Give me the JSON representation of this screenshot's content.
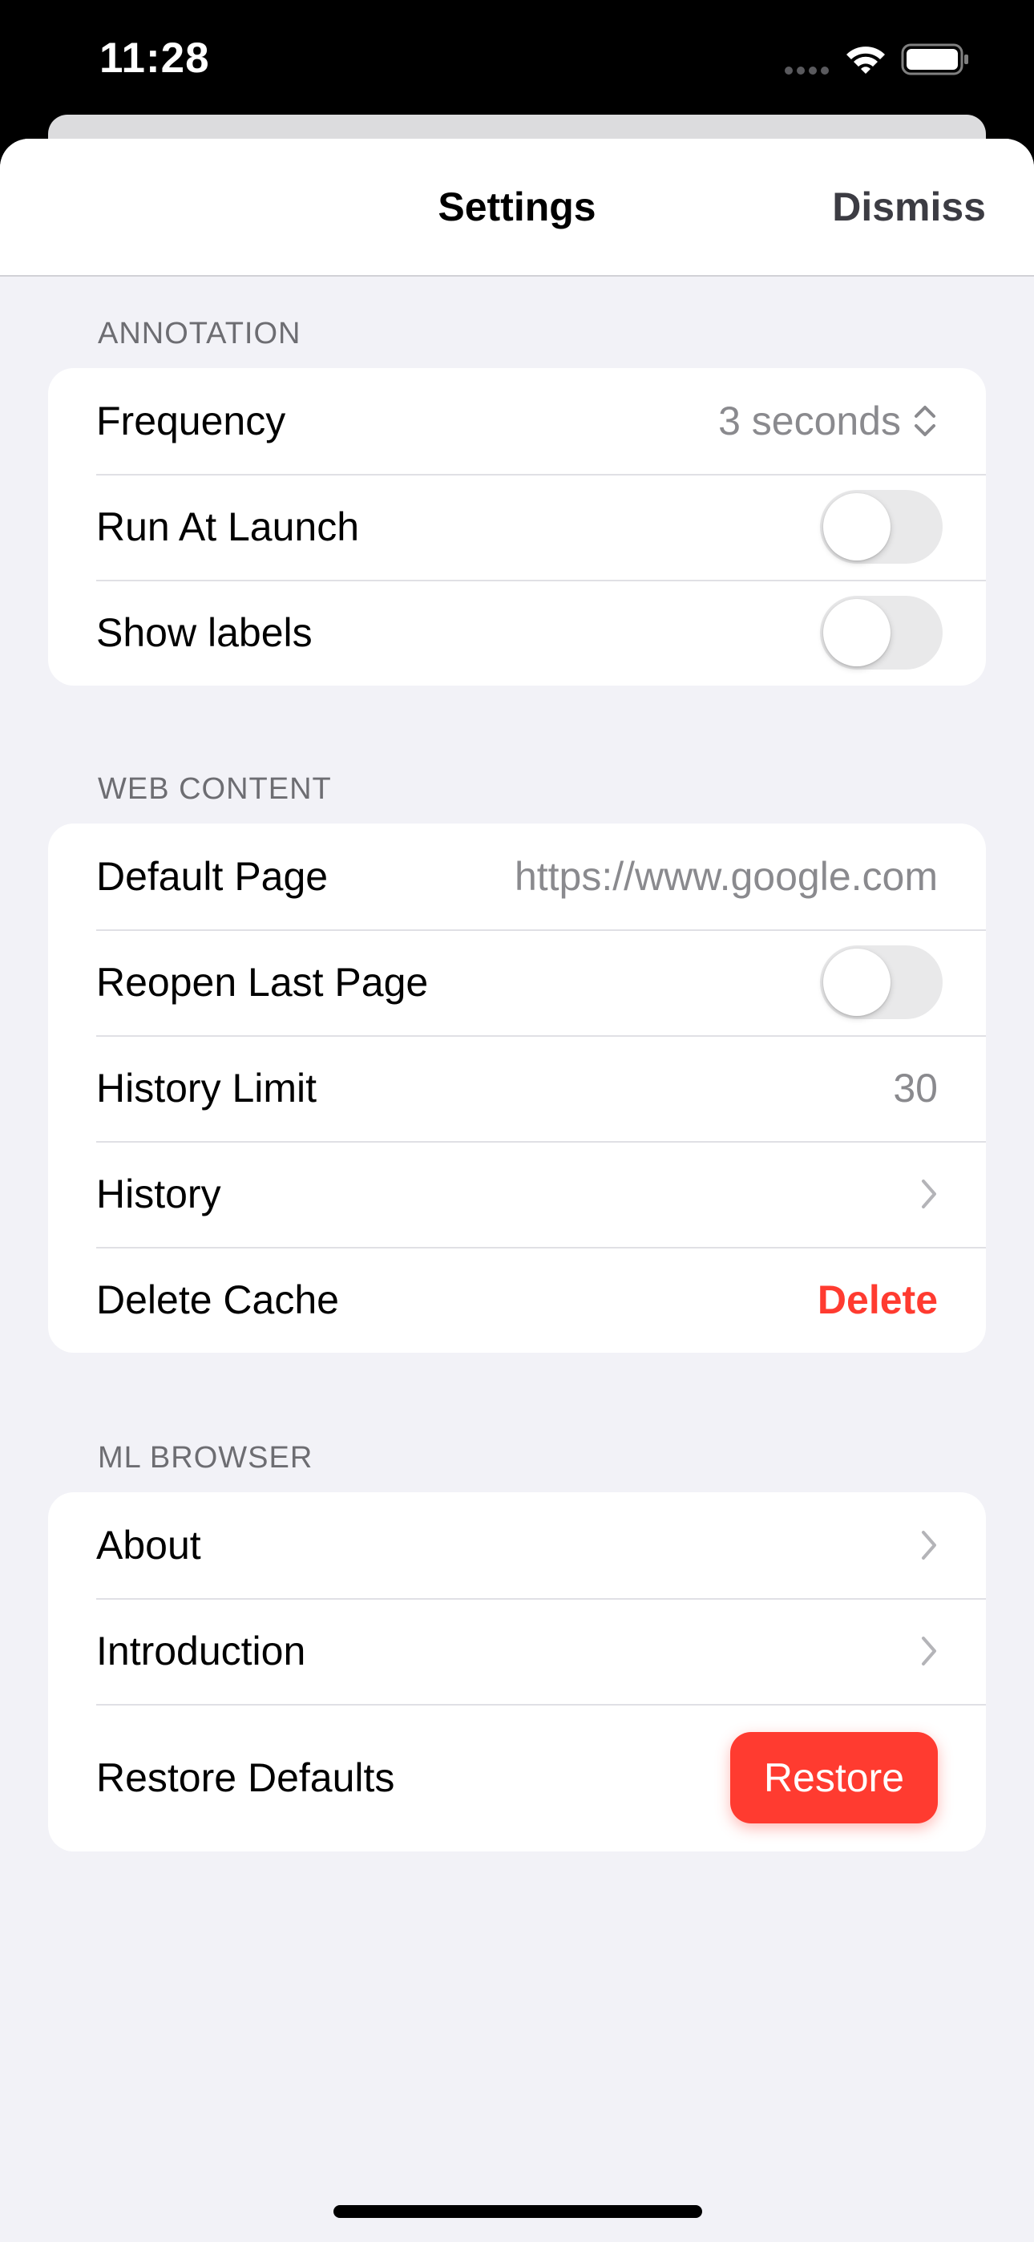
{
  "status_bar": {
    "time": "11:28"
  },
  "nav": {
    "title": "Settings",
    "dismiss_label": "Dismiss"
  },
  "annotation": {
    "header": "ANNOTATION",
    "frequency_label": "Frequency",
    "frequency_value": "3 seconds",
    "run_at_launch_label": "Run At Launch",
    "run_at_launch_on": false,
    "show_labels_label": "Show labels",
    "show_labels_on": false
  },
  "web_content": {
    "header": "WEB CONTENT",
    "default_page_label": "Default Page",
    "default_page_placeholder": "https://www.google.com",
    "reopen_last_page_label": "Reopen Last Page",
    "reopen_last_page_on": false,
    "history_limit_label": "History Limit",
    "history_limit_value": "30",
    "history_label": "History",
    "delete_cache_label": "Delete Cache",
    "delete_label": "Delete"
  },
  "ml_browser": {
    "header": "ML BROWSER",
    "about_label": "About",
    "introduction_label": "Introduction",
    "restore_defaults_label": "Restore Defaults",
    "restore_label": "Restore"
  },
  "colors": {
    "accent_red": "#ff3b30",
    "background": "#f2f2f7",
    "secondary_text": "#8a8a8e"
  },
  "icons": [
    "signal-icon",
    "wifi-icon",
    "battery-icon",
    "updown-icon",
    "chevron-right-icon"
  ]
}
